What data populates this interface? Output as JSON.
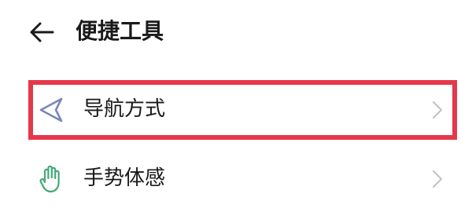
{
  "header": {
    "back_icon": "arrow-left-icon",
    "title": "便捷工具"
  },
  "items": [
    {
      "label": "导航方式",
      "icon": "navigation-triangle-icon",
      "icon_color": "#7b86b8",
      "chevron_icon": "chevron-right-icon",
      "highlighted": true
    },
    {
      "label": "手势体感",
      "icon": "hand-gesture-icon",
      "icon_color": "#43a878",
      "chevron_icon": "chevron-right-icon",
      "highlighted": false
    }
  ],
  "colors": {
    "highlight": "#e5374a",
    "text": "#1a1a1a",
    "chevron": "#c4c4c4"
  }
}
